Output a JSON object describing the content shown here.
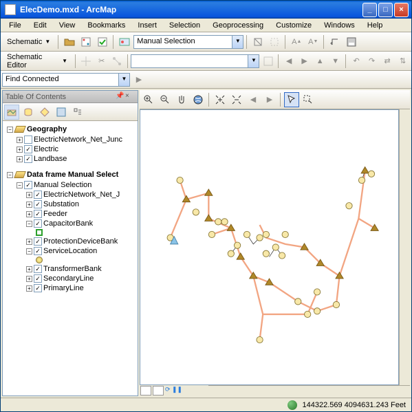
{
  "title": "ElecDemo.mxd - ArcMap",
  "menu": {
    "file": "File",
    "edit": "Edit",
    "view": "View",
    "bookmarks": "Bookmarks",
    "insert": "Insert",
    "selection": "Selection",
    "geoprocessing": "Geoprocessing",
    "customize": "Customize",
    "windows": "Windows",
    "help": "Help"
  },
  "toolbar1": {
    "schematic": "Schematic",
    "combo": "Manual Selection"
  },
  "toolbar2": {
    "schematicEditor": "Schematic Editor",
    "combo": ""
  },
  "find": {
    "value": "Find Connected"
  },
  "toc": {
    "title": "Table Of Contents"
  },
  "tree": {
    "geography": "Geography",
    "enet": "ElectricNetwork_Net_Junc",
    "electric": "Electric",
    "landbase": "Landbase",
    "dfms": "Data frame Manual Select",
    "manual": "Manual Selection",
    "enetj": "ElectricNetwork_Net_J",
    "sub": "Substation",
    "feeder": "Feeder",
    "cap": "CapacitorBank",
    "prot": "ProtectionDeviceBank",
    "svc": "ServiceLocation",
    "xfmr": "TransformerBank",
    "secline": "SecondaryLine",
    "primline": "PrimaryLine"
  },
  "status": {
    "coords": "144322.569 4094631.243 Feet"
  }
}
